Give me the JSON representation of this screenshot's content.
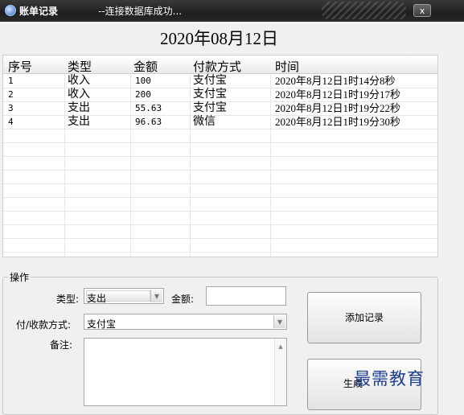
{
  "window": {
    "title": "账单记录",
    "status": "--连接数据库成功...",
    "close_label": "x"
  },
  "date_title": "2020年08月12日",
  "table": {
    "headers": [
      "序号",
      "类型",
      "金额",
      "付款方式",
      "时间"
    ],
    "rows": [
      [
        "1",
        "收入",
        "100",
        "支付宝",
        "2020年8月12日1时14分8秒"
      ],
      [
        "2",
        "收入",
        "200",
        "支付宝",
        "2020年8月12日1时19分17秒"
      ],
      [
        "3",
        "支出",
        "55.63",
        "支付宝",
        "2020年8月12日1时19分22秒"
      ],
      [
        "4",
        "支出",
        "96.63",
        "微信",
        "2020年8月12日1时19分30秒"
      ]
    ]
  },
  "form": {
    "group_label": "操作",
    "type_label": "类型:",
    "type_value": "支出",
    "amount_label": "金额:",
    "amount_value": "",
    "payment_label": "付/收款方式:",
    "payment_value": "支付宝",
    "note_label": "备注:",
    "note_value": ""
  },
  "buttons": {
    "add": "添加记录",
    "generate": "生成"
  },
  "watermark": "最需教育",
  "colors": {
    "titlebar": "#2a2a2a",
    "watermark": "#1f3d8f"
  }
}
